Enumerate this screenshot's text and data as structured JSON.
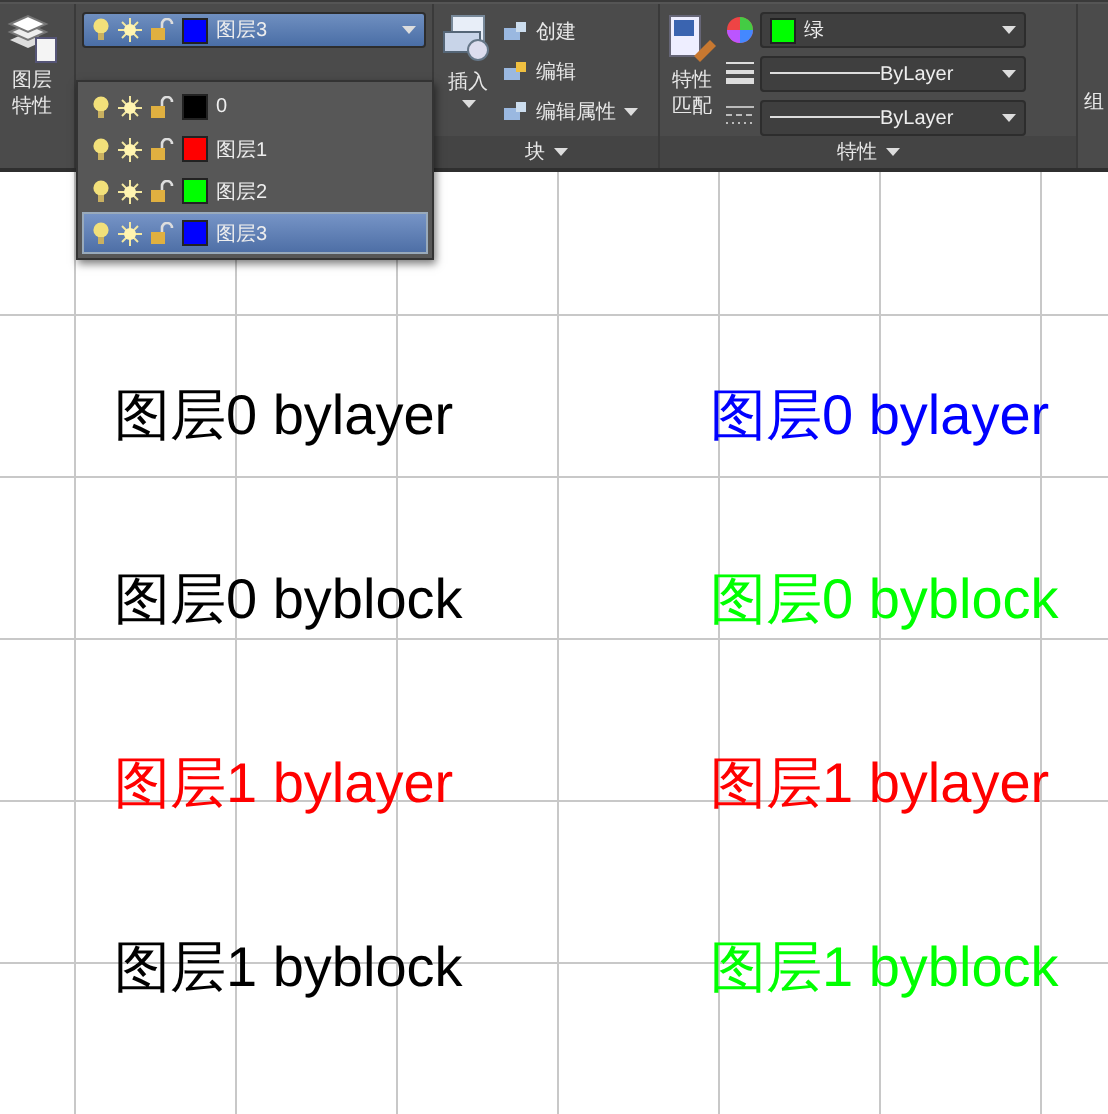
{
  "layer_panel": {
    "properties_button": "图层特性",
    "current_layer": {
      "name": "图层3",
      "color": "#0000ff"
    },
    "layers": [
      {
        "name": "0",
        "color": "#000000",
        "selected": false
      },
      {
        "name": "图层1",
        "color": "#ff0000",
        "selected": false
      },
      {
        "name": "图层2",
        "color": "#00ff00",
        "selected": false
      },
      {
        "name": "图层3",
        "color": "#0000ff",
        "selected": true
      }
    ]
  },
  "block_panel": {
    "insert_button": "插入",
    "tools": [
      "创建",
      "编辑",
      "编辑属性"
    ],
    "title": "块"
  },
  "properties_panel": {
    "match_button": "特性匹配",
    "color_combo": {
      "value": "绿",
      "color": "#00ff00"
    },
    "lineweight_combo": "ByLayer",
    "linetype_combo": "ByLayer",
    "title": "特性"
  },
  "next_panel_cut": "组",
  "canvas_texts": [
    {
      "text": "图层0 bylayer",
      "color": "#000000"
    },
    {
      "text": "图层0 bylayer",
      "color": "#0000ff"
    },
    {
      "text": "图层0 byblock",
      "color": "#000000"
    },
    {
      "text": "图层0 byblock",
      "color": "#00ff00"
    },
    {
      "text": "图层1 bylayer",
      "color": "#ff0000"
    },
    {
      "text": "图层1 bylayer",
      "color": "#ff0000"
    },
    {
      "text": "图层1 byblock",
      "color": "#000000"
    },
    {
      "text": "图层1 byblock",
      "color": "#00ff00"
    }
  ]
}
